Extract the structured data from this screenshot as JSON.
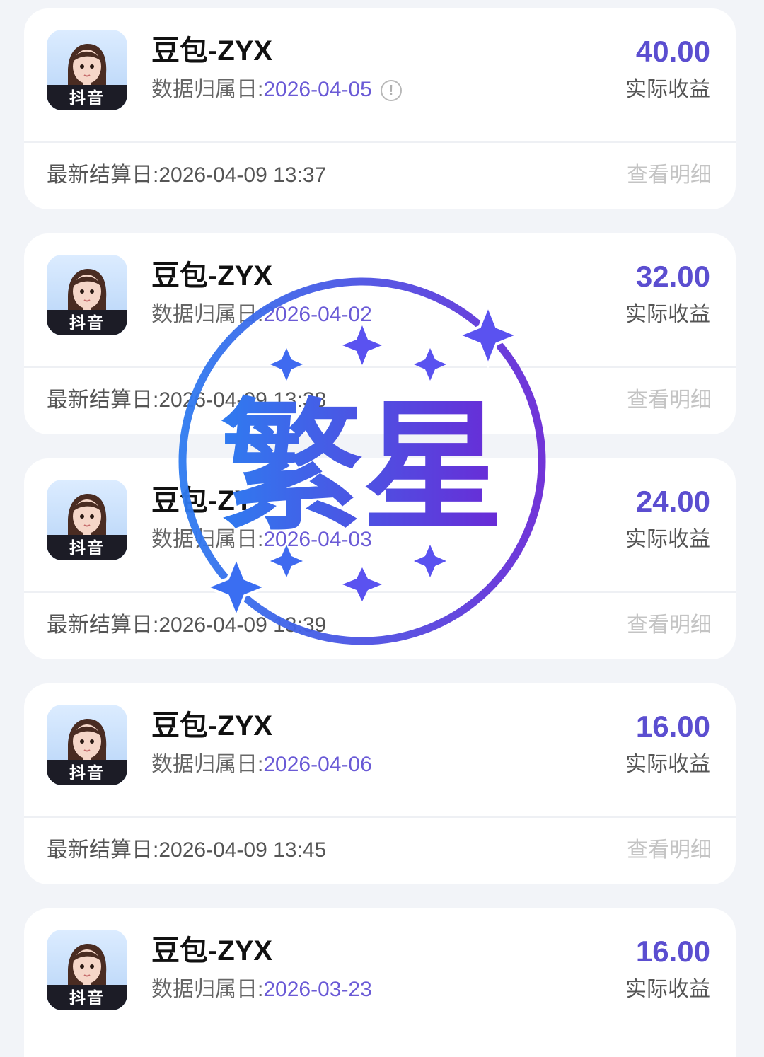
{
  "records": [
    {
      "name": "豆包-ZYX",
      "date_label": "数据归属日:",
      "date": "2026-04-05",
      "has_info_icon": true,
      "amount": "40.00",
      "amount_label": "实际收益",
      "settle_text": "最新结算日:2026-04-09 13:37",
      "detail_label": "查看明细",
      "platform": "抖音"
    },
    {
      "name": "豆包-ZYX",
      "date_label": "数据归属日:",
      "date": "2026-04-02",
      "has_info_icon": false,
      "amount": "32.00",
      "amount_label": "实际收益",
      "settle_text": "最新结算日:2026-04-09 13:38",
      "detail_label": "查看明细",
      "platform": "抖音"
    },
    {
      "name": "豆包-ZYX",
      "date_label": "数据归属日:",
      "date": "2026-04-03",
      "has_info_icon": false,
      "amount": "24.00",
      "amount_label": "实际收益",
      "settle_text": "最新结算日:2026-04-09 13:39",
      "detail_label": "查看明细",
      "platform": "抖音"
    },
    {
      "name": "豆包-ZYX",
      "date_label": "数据归属日:",
      "date": "2026-04-06",
      "has_info_icon": false,
      "amount": "16.00",
      "amount_label": "实际收益",
      "settle_text": "最新结算日:2026-04-09 13:45",
      "detail_label": "查看明细",
      "platform": "抖音"
    },
    {
      "name": "豆包-ZYX",
      "date_label": "数据归属日:",
      "date": "2026-03-23",
      "has_info_icon": false,
      "amount": "16.00",
      "amount_label": "实际收益",
      "settle_text": "",
      "detail_label": "",
      "platform": "抖音"
    }
  ],
  "watermark": {
    "text": "繁星",
    "icon": "star-seal-icon"
  },
  "colors": {
    "accent": "#5b4ed0",
    "date": "#6a5ad6",
    "background": "#f2f4f8",
    "card": "#ffffff",
    "watermark_start": "#2f7bf0",
    "watermark_end": "#6a2ad6"
  }
}
